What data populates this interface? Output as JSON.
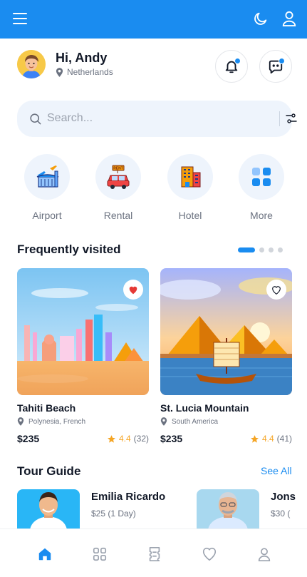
{
  "header": {
    "menu_icon": "hamburger-menu-icon",
    "theme_icon": "moon-icon",
    "profile_icon": "user-icon",
    "bar_color": "#1a8cf0"
  },
  "user": {
    "greeting": "Hi, Andy",
    "location": "Netherlands"
  },
  "search": {
    "placeholder": "Search..."
  },
  "categories": [
    {
      "label": "Airport",
      "icon": "airport-icon"
    },
    {
      "label": "Rental",
      "icon": "rental-car-icon"
    },
    {
      "label": "Hotel",
      "icon": "hotel-icon"
    },
    {
      "label": "More",
      "icon": "grid-more-icon"
    }
  ],
  "frequently_visited": {
    "title": "Frequently visited",
    "pager": {
      "pages": 4,
      "active": 1
    },
    "items": [
      {
        "name": "Tahiti Beach",
        "location": "Polynesia, French",
        "price": "$235",
        "rating": "4.4",
        "reviews": "(32)",
        "favorited": true
      },
      {
        "name": "St. Lucia Mountain",
        "location": "South America",
        "price": "$235",
        "rating": "4.4",
        "reviews": "(41)",
        "favorited": false
      }
    ]
  },
  "tour_guide": {
    "title": "Tour Guide",
    "see_all": "See All",
    "guides": [
      {
        "name": "Emilia Ricardo",
        "rate": "$25 (1 Day)"
      },
      {
        "name": "Jons",
        "rate": "$30 ("
      }
    ]
  },
  "bottom_nav": {
    "items": [
      "home-icon",
      "grid-icon",
      "ticket-icon",
      "heart-icon",
      "user-icon"
    ],
    "active": "home-icon",
    "accent": "#1a8cf0"
  }
}
